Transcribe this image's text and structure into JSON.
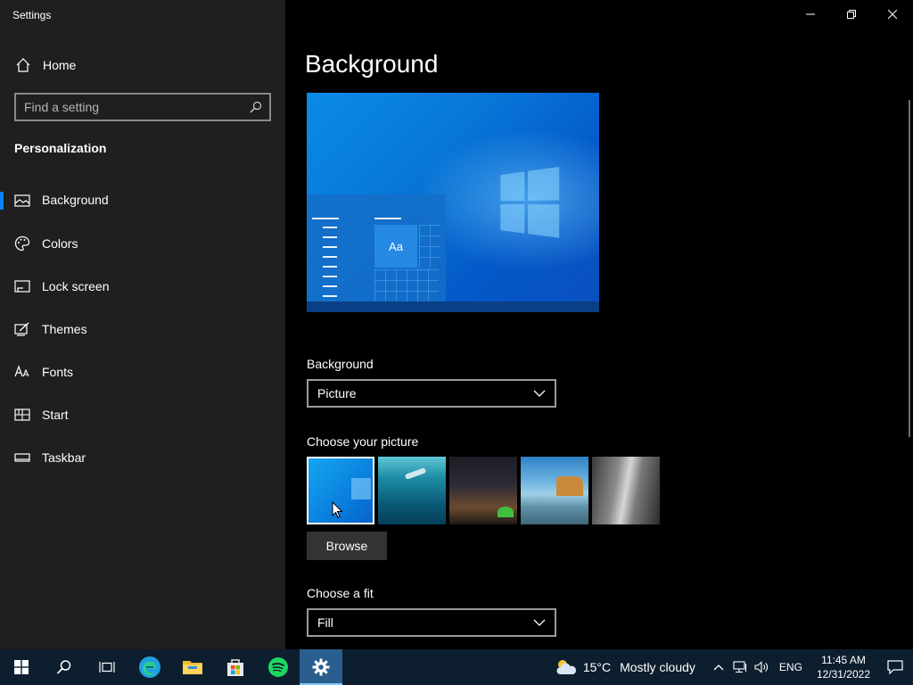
{
  "app": {
    "title": "Settings"
  },
  "window_controls": {
    "minimize_icon": "minimize-icon",
    "restore_icon": "restore-icon",
    "close_icon": "close-icon"
  },
  "sidebar": {
    "home_label": "Home",
    "search_placeholder": "Find a setting",
    "section_title": "Personalization",
    "items": [
      {
        "label": "Background",
        "icon": "image-icon",
        "selected": true
      },
      {
        "label": "Colors",
        "icon": "palette-icon"
      },
      {
        "label": "Lock screen",
        "icon": "lock-screen-icon"
      },
      {
        "label": "Themes",
        "icon": "themes-icon"
      },
      {
        "label": "Fonts",
        "icon": "fonts-icon"
      },
      {
        "label": "Start",
        "icon": "start-icon"
      },
      {
        "label": "Taskbar",
        "icon": "taskbar-icon"
      }
    ]
  },
  "main": {
    "title": "Background",
    "preview": {
      "tile_text": "Aa"
    },
    "background_label": "Background",
    "background_value": "Picture",
    "choose_picture_label": "Choose your picture",
    "pictures": [
      {
        "name": "windows-blue",
        "selected": true
      },
      {
        "name": "underwater-swimmer"
      },
      {
        "name": "night-sky-tent"
      },
      {
        "name": "beach-rocks"
      },
      {
        "name": "cliff-face"
      }
    ],
    "browse_label": "Browse",
    "fit_label": "Choose a fit",
    "fit_value": "Fill"
  },
  "taskbar": {
    "apps": [
      "start-icon",
      "search-icon",
      "task-view-icon",
      "edge-icon",
      "file-explorer-icon",
      "store-icon",
      "spotify-icon",
      "settings-icon"
    ],
    "active_app": "settings-icon",
    "weather": {
      "temp": "15°C",
      "condition": "Mostly cloudy"
    },
    "language": "ENG",
    "time": "11:45 AM",
    "date": "12/31/2022"
  },
  "colors": {
    "accent": "#0a84ff",
    "taskbar": "#0d1e2e",
    "sidebar": "#1f1f1f"
  }
}
